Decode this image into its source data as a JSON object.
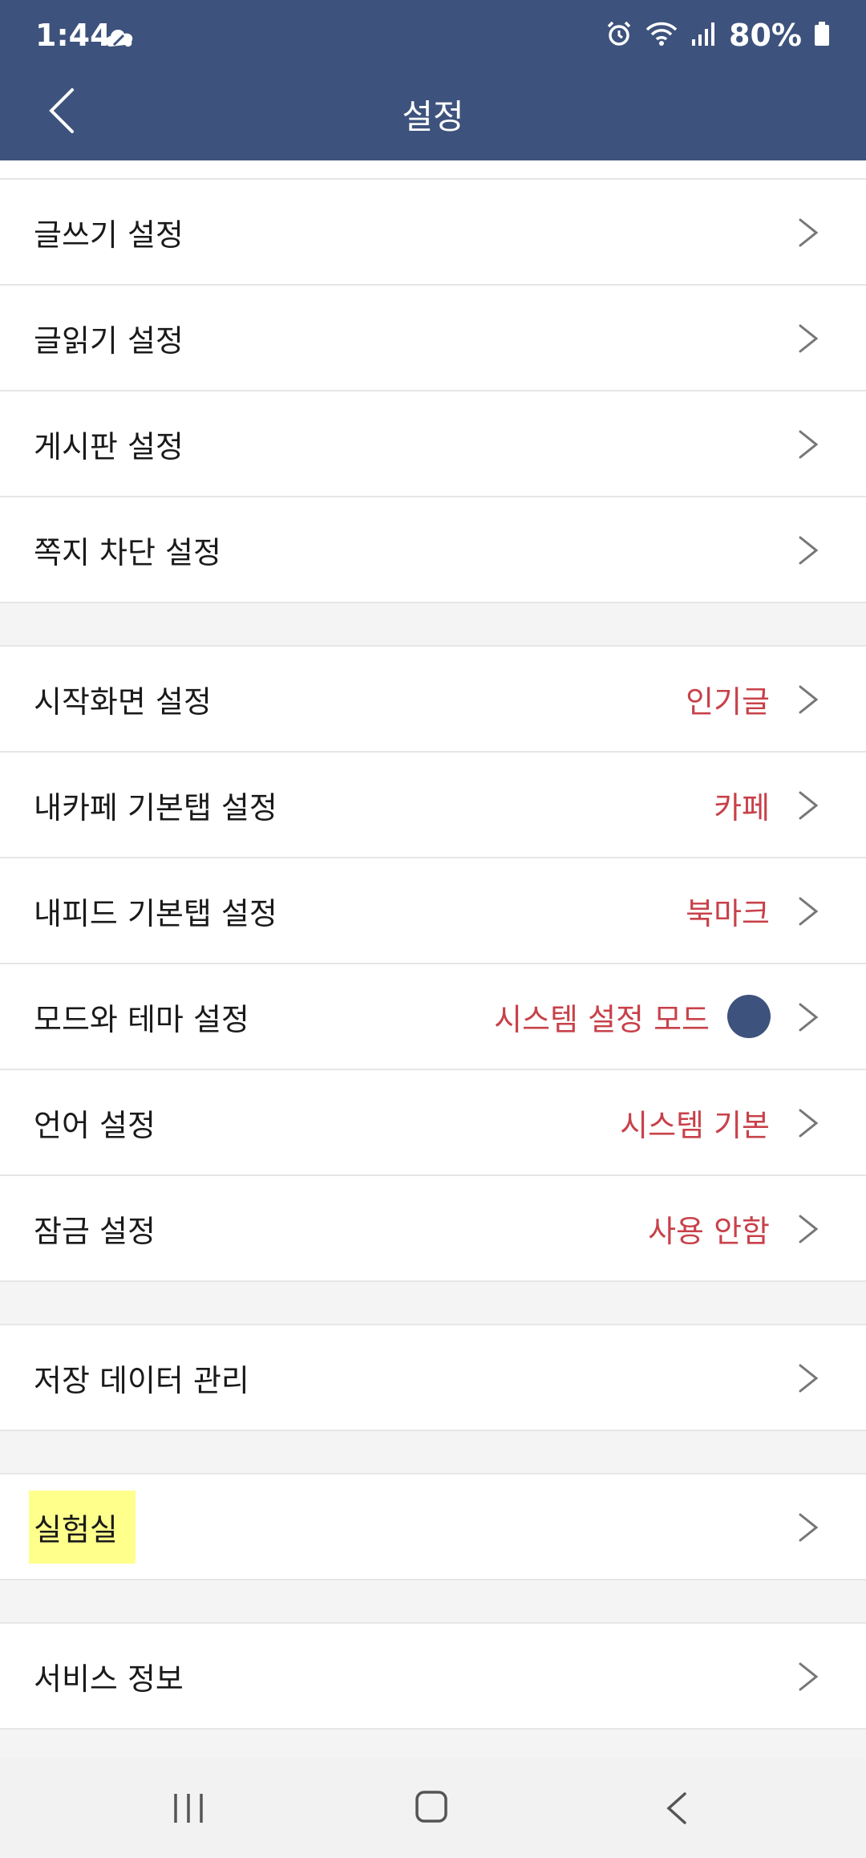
{
  "status": {
    "time": "1:44",
    "battery": "80%"
  },
  "header": {
    "title": "설정"
  },
  "groups": [
    [
      {
        "label": "글쓰기 설정"
      },
      {
        "label": "글읽기 설정"
      },
      {
        "label": "게시판 설정"
      },
      {
        "label": "쪽지 차단 설정"
      }
    ],
    [
      {
        "label": "시작화면 설정",
        "value": "인기글"
      },
      {
        "label": "내카페 기본탭 설정",
        "value": "카페"
      },
      {
        "label": "내피드 기본탭 설정",
        "value": "북마크"
      },
      {
        "label": "모드와 테마 설정",
        "value": "시스템 설정 모드"
      },
      {
        "label": "언어 설정",
        "value": "시스템 기본"
      },
      {
        "label": "잠금 설정",
        "value": "사용 안함"
      }
    ],
    [
      {
        "label": "저장 데이터 관리"
      }
    ],
    [
      {
        "label": "실험실"
      }
    ],
    [
      {
        "label": "서비스 정보"
      }
    ]
  ],
  "colors": {
    "header": "#3d527c",
    "value_text": "#c8414a",
    "highlight": "#ffff8c",
    "theme_dot": "#3d527c"
  }
}
